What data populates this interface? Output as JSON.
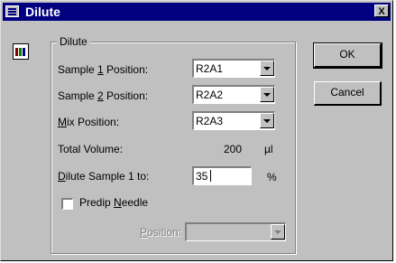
{
  "window": {
    "title": "Dilute",
    "close_glyph": "X"
  },
  "group": {
    "label": "Dilute"
  },
  "fields": {
    "sample1": {
      "label_pre": "Sample ",
      "label_acc": "1",
      "label_post": " Position:",
      "value": "R2A1"
    },
    "sample2": {
      "label_pre": "Sample ",
      "label_acc": "2",
      "label_post": " Position:",
      "value": "R2A2"
    },
    "mix": {
      "label_pre": "",
      "label_acc": "M",
      "label_post": "ix Position:",
      "value": "R2A3"
    },
    "total_volume": {
      "label": "Total Volume:",
      "value": "200",
      "unit": "µl"
    },
    "dilute": {
      "label_pre": "",
      "label_acc": "D",
      "label_post": "ilute Sample 1 to:",
      "value": "35",
      "unit": "%"
    },
    "predip": {
      "label_pre": "Predip ",
      "label_acc": "N",
      "label_post": "eedle",
      "checked": false
    },
    "position": {
      "label_pre": "",
      "label_acc": "P",
      "label_post": "osition:",
      "value": ""
    }
  },
  "buttons": {
    "ok": "OK",
    "cancel": "Cancel"
  },
  "icons": {
    "title": "window-icon",
    "dilute": "dilute-icon"
  }
}
